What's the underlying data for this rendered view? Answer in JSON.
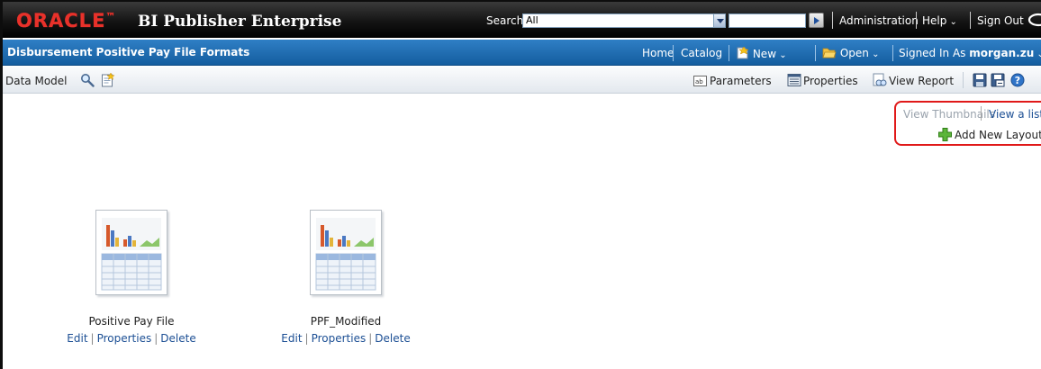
{
  "brand": {
    "logo_text": "ORACLE",
    "app_title": "BI Publisher Enterprise"
  },
  "topbar": {
    "search_label": "Search",
    "search_scope": "All",
    "search_value": "",
    "administration": "Administration",
    "help": "Help",
    "sign_out": "Sign Out"
  },
  "titlebar": {
    "page_title": "Disbursement Positive Pay File Formats",
    "home": "Home",
    "catalog": "Catalog",
    "new": "New",
    "open": "Open",
    "signed_in_as": "Signed In As",
    "username": "morgan.zu"
  },
  "toolbar": {
    "data_model": "Data Model",
    "parameters": "Parameters",
    "properties": "Properties",
    "view_report": "View Report"
  },
  "view_switch": {
    "thumbnails": "View Thumbnails",
    "list": "View a list",
    "add_new_layout": "Add New Layout"
  },
  "layouts": [
    {
      "name": "Positive Pay File",
      "edit": "Edit",
      "properties": "Properties",
      "delete": "Delete"
    },
    {
      "name": "PPF_Modified",
      "edit": "Edit",
      "properties": "Properties",
      "delete": "Delete"
    }
  ],
  "colors": {
    "oracle_red": "#e8312a",
    "title_blue": "#1d6db4",
    "link_blue": "#1c4f94",
    "highlight_red": "#e01919"
  }
}
